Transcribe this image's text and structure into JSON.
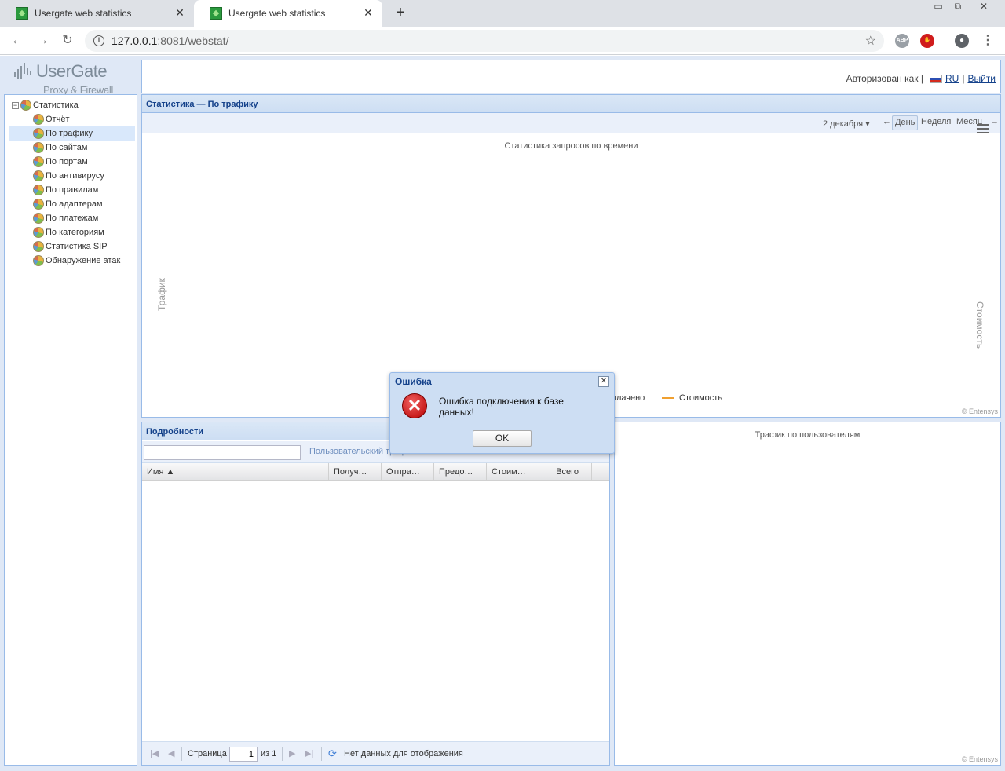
{
  "browser": {
    "tabs": [
      {
        "title": "Usergate web statistics"
      },
      {
        "title": "Usergate web statistics"
      }
    ],
    "url_host": "127.0.0.1",
    "url_rest": ":8081/webstat/",
    "ext_abp": "ABP"
  },
  "logo": {
    "name": "UserGate",
    "tagline": "Proxy & Firewall"
  },
  "header": {
    "auth_label": "Авторизован как |",
    "lang": "RU",
    "separator": "|",
    "logout": "Выйти"
  },
  "sidebar": {
    "root": "Статистика",
    "items": [
      {
        "label": "Отчёт"
      },
      {
        "label": "По трафику"
      },
      {
        "label": "По сайтам"
      },
      {
        "label": "По портам"
      },
      {
        "label": "По антивирусу"
      },
      {
        "label": "По правилам"
      },
      {
        "label": "По адаптерам"
      },
      {
        "label": "По платежам"
      },
      {
        "label": "По категориям"
      },
      {
        "label": "Статистика SIP"
      },
      {
        "label": "Обнаружение атак"
      }
    ],
    "selected_index": 1
  },
  "chart_panel": {
    "title": "Статистика — По трафику",
    "date": "2 декабря ▾",
    "prev": "←",
    "day": "День",
    "week": "Неделя",
    "month": "Месяц",
    "next": "→",
    "chart_title": "Статистика запросов по времени",
    "y_left": "Трафик",
    "y_right": "Стоимость",
    "legend_paid": "плачено",
    "legend_cost": "Стоимость",
    "legend_cost_color": "#f0a030",
    "credit": "© Entensys"
  },
  "details": {
    "title": "Подробности",
    "user_traffic_link": "Пользовательский трафик",
    "columns": [
      "Имя ▲",
      "Получ…",
      "Отпра…",
      "Предо…",
      "Стоим…",
      "Всего"
    ],
    "pager_page": "Страница",
    "pager_value": "1",
    "pager_of": "из 1",
    "pager_empty": "Нет данных для отображения"
  },
  "users_panel": {
    "title": "Трафик по пользователям",
    "credit": "© Entensys"
  },
  "dialog": {
    "title": "Ошибка",
    "message": "Ошибка подключения к базе данных!",
    "ok": "OK"
  }
}
